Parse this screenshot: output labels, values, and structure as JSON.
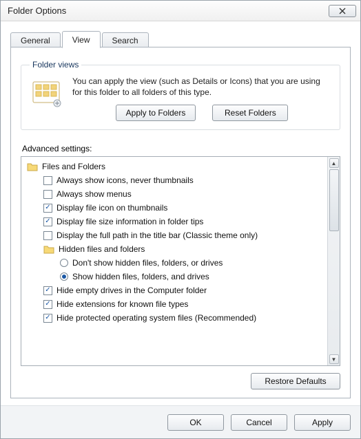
{
  "window": {
    "title": "Folder Options"
  },
  "tabs": {
    "general": "General",
    "view": "View",
    "search": "Search"
  },
  "folderViews": {
    "legend": "Folder views",
    "text": "You can apply the view (such as Details or Icons) that you are using for this folder to all folders of this type.",
    "applyBtn": "Apply to Folders",
    "resetBtn": "Reset Folders"
  },
  "advanced": {
    "label": "Advanced settings:",
    "filesAndFolders": "Files and Folders",
    "items": {
      "alwaysIcons": "Always show icons, never thumbnails",
      "alwaysMenus": "Always show menus",
      "displayFileIcon": "Display file icon on thumbnails",
      "displayFileSize": "Display file size information in folder tips",
      "displayFullPath": "Display the full path in the title bar (Classic theme only)",
      "hiddenGroup": "Hidden files and folders",
      "dontShowHidden": "Don't show hidden files, folders, or drives",
      "showHidden": "Show hidden files, folders, and drives",
      "hideEmptyDrives": "Hide empty drives in the Computer folder",
      "hideExtensions": "Hide extensions for known file types",
      "hideProtectedOS": "Hide protected operating system files (Recommended)"
    },
    "restoreBtn": "Restore Defaults"
  },
  "footer": {
    "ok": "OK",
    "cancel": "Cancel",
    "apply": "Apply"
  }
}
